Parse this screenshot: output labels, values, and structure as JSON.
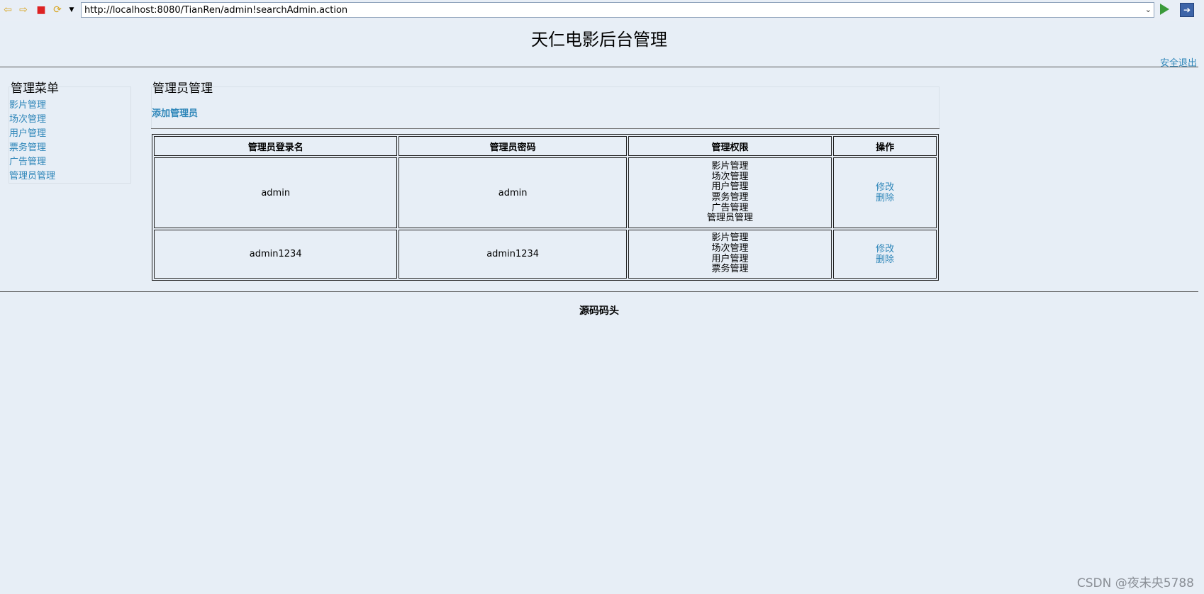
{
  "browser": {
    "url": "http://localhost:8080/TianRen/admin!searchAdmin.action"
  },
  "site": {
    "title": "天仁电影后台管理",
    "logout_label": "安全退出"
  },
  "sidebar": {
    "title": "管理菜单",
    "items": [
      {
        "label": "影片管理"
      },
      {
        "label": "场次管理"
      },
      {
        "label": "用户管理"
      },
      {
        "label": "票务管理"
      },
      {
        "label": "广告管理"
      },
      {
        "label": "管理员管理"
      }
    ]
  },
  "main": {
    "title": "管理员管理",
    "add_label": "添加管理员",
    "table": {
      "headers": [
        "管理员登录名",
        "管理员密码",
        "管理权限",
        "操作"
      ],
      "rows": [
        {
          "login": "admin",
          "password": "admin",
          "permissions": [
            "影片管理",
            "场次管理",
            "用户管理",
            "票务管理",
            "广告管理",
            "管理员管理"
          ],
          "edit_label": "修改",
          "delete_label": "删除"
        },
        {
          "login": "admin1234",
          "password": "admin1234",
          "permissions": [
            "影片管理",
            "场次管理",
            "用户管理",
            "票务管理"
          ],
          "edit_label": "修改",
          "delete_label": "删除"
        }
      ]
    }
  },
  "footer": {
    "text": "源码码头"
  },
  "watermark": "CSDN @夜未央5788",
  "colors": {
    "link": "#2e86b9",
    "background": "#e7eef6"
  }
}
